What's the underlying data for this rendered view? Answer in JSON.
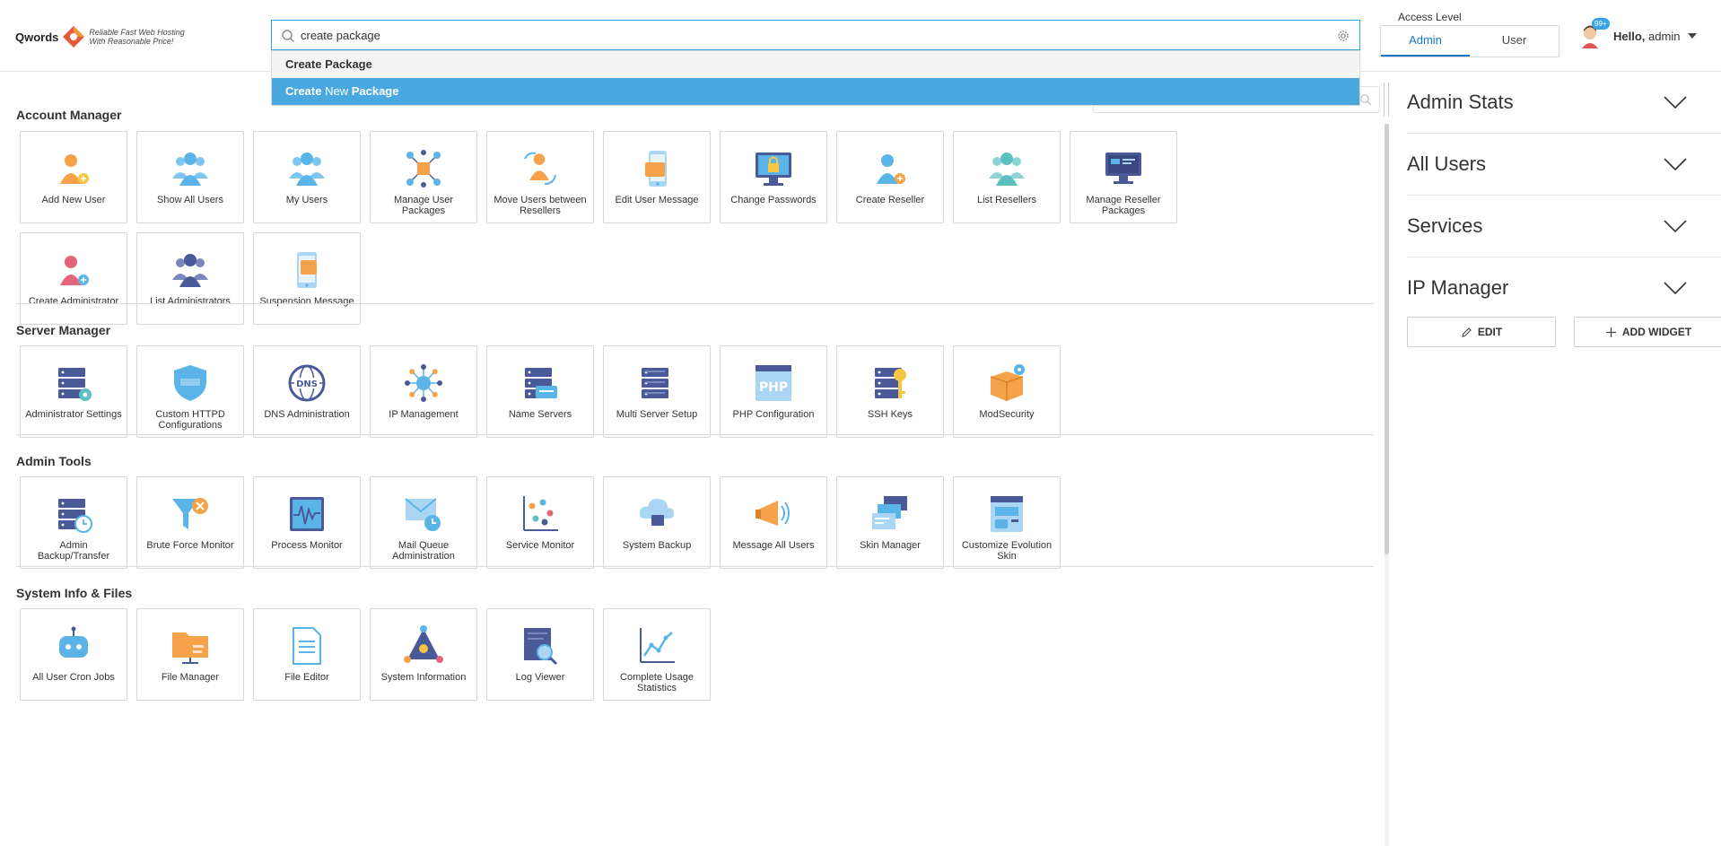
{
  "header": {
    "logo_word": "Qwords",
    "logo_tagline_1": "Reliable Fast Web Hosting",
    "logo_tagline_2": "With Reasonable Price!",
    "search_value": "create package",
    "dropdown": {
      "first": "Create Package",
      "active_part1": "Create",
      "active_part2": " New ",
      "active_part3": "Package"
    },
    "access_level": {
      "label": "Access Level",
      "options": [
        "Admin",
        "User"
      ],
      "selected": "Admin"
    },
    "user": {
      "badge": "99+",
      "greeting": "Hello,",
      "name": "admin"
    }
  },
  "sections": [
    {
      "title": "Account Manager",
      "items": [
        {
          "label": "Add New User",
          "icon": "add-user-icon"
        },
        {
          "label": "Show All Users",
          "icon": "users-group-icon"
        },
        {
          "label": "My Users",
          "icon": "my-users-icon"
        },
        {
          "label": "Manage User Packages",
          "icon": "packages-network-icon"
        },
        {
          "label": "Move Users between Resellers",
          "icon": "move-users-icon"
        },
        {
          "label": "Edit User Message",
          "icon": "phone-message-icon"
        },
        {
          "label": "Change Passwords",
          "icon": "monitor-lock-icon"
        },
        {
          "label": "Create Reseller",
          "icon": "create-reseller-icon"
        },
        {
          "label": "List Resellers",
          "icon": "list-resellers-icon"
        },
        {
          "label": "Manage Reseller Packages",
          "icon": "reseller-packages-icon"
        },
        {
          "label": "Create Administrator",
          "icon": "create-admin-icon"
        },
        {
          "label": "List Administrators",
          "icon": "list-admins-icon"
        },
        {
          "label": "Suspension Message",
          "icon": "suspension-message-icon"
        }
      ]
    },
    {
      "title": "Server Manager",
      "items": [
        {
          "label": "Administrator Settings",
          "icon": "server-gear-icon"
        },
        {
          "label": "Custom HTTPD Configurations",
          "icon": "httpd-shield-icon"
        },
        {
          "label": "DNS Administration",
          "icon": "dns-globe-icon"
        },
        {
          "label": "IP Management",
          "icon": "ip-network-icon"
        },
        {
          "label": "Name Servers",
          "icon": "name-servers-icon"
        },
        {
          "label": "Multi Server Setup",
          "icon": "multi-server-icon"
        },
        {
          "label": "PHP Configuration",
          "icon": "php-icon"
        },
        {
          "label": "SSH Keys",
          "icon": "ssh-key-icon"
        },
        {
          "label": "ModSecurity",
          "icon": "modsecurity-box-icon"
        }
      ]
    },
    {
      "title": "Admin Tools",
      "items": [
        {
          "label": "Admin Backup/Transfer",
          "icon": "backup-clock-icon"
        },
        {
          "label": "Brute Force Monitor",
          "icon": "brute-force-filter-icon"
        },
        {
          "label": "Process Monitor",
          "icon": "process-monitor-icon"
        },
        {
          "label": "Mail Queue Administration",
          "icon": "mail-queue-icon"
        },
        {
          "label": "Service Monitor",
          "icon": "service-monitor-icon"
        },
        {
          "label": "System Backup",
          "icon": "cloud-backup-icon"
        },
        {
          "label": "Message All Users",
          "icon": "megaphone-icon"
        },
        {
          "label": "Skin Manager",
          "icon": "skin-manager-icon"
        },
        {
          "label": "Customize Evolution Skin",
          "icon": "customize-skin-icon"
        }
      ]
    },
    {
      "title": "System Info & Files",
      "items": [
        {
          "label": "All User Cron Jobs",
          "icon": "cron-robot-icon"
        },
        {
          "label": "File Manager",
          "icon": "file-manager-folder-icon"
        },
        {
          "label": "File Editor",
          "icon": "file-editor-icon"
        },
        {
          "label": "System Information",
          "icon": "system-info-icon"
        },
        {
          "label": "Log Viewer",
          "icon": "log-viewer-icon"
        },
        {
          "label": "Complete Usage Statistics",
          "icon": "usage-stats-chart-icon"
        }
      ]
    }
  ],
  "right_panel": {
    "widgets": [
      "Admin Stats",
      "All Users",
      "Services",
      "IP Manager"
    ],
    "edit_label": "EDIT",
    "add_widget_label": "ADD WIDGET"
  },
  "colors": {
    "accent": "#3aa3e3",
    "dropdown_active": "#4aa8e0",
    "icon_blue": "#5ab4e8",
    "icon_orange": "#f6a24b",
    "icon_navy": "#4a5a99",
    "icon_red": "#e2657a",
    "icon_teal": "#5cc0c0"
  }
}
